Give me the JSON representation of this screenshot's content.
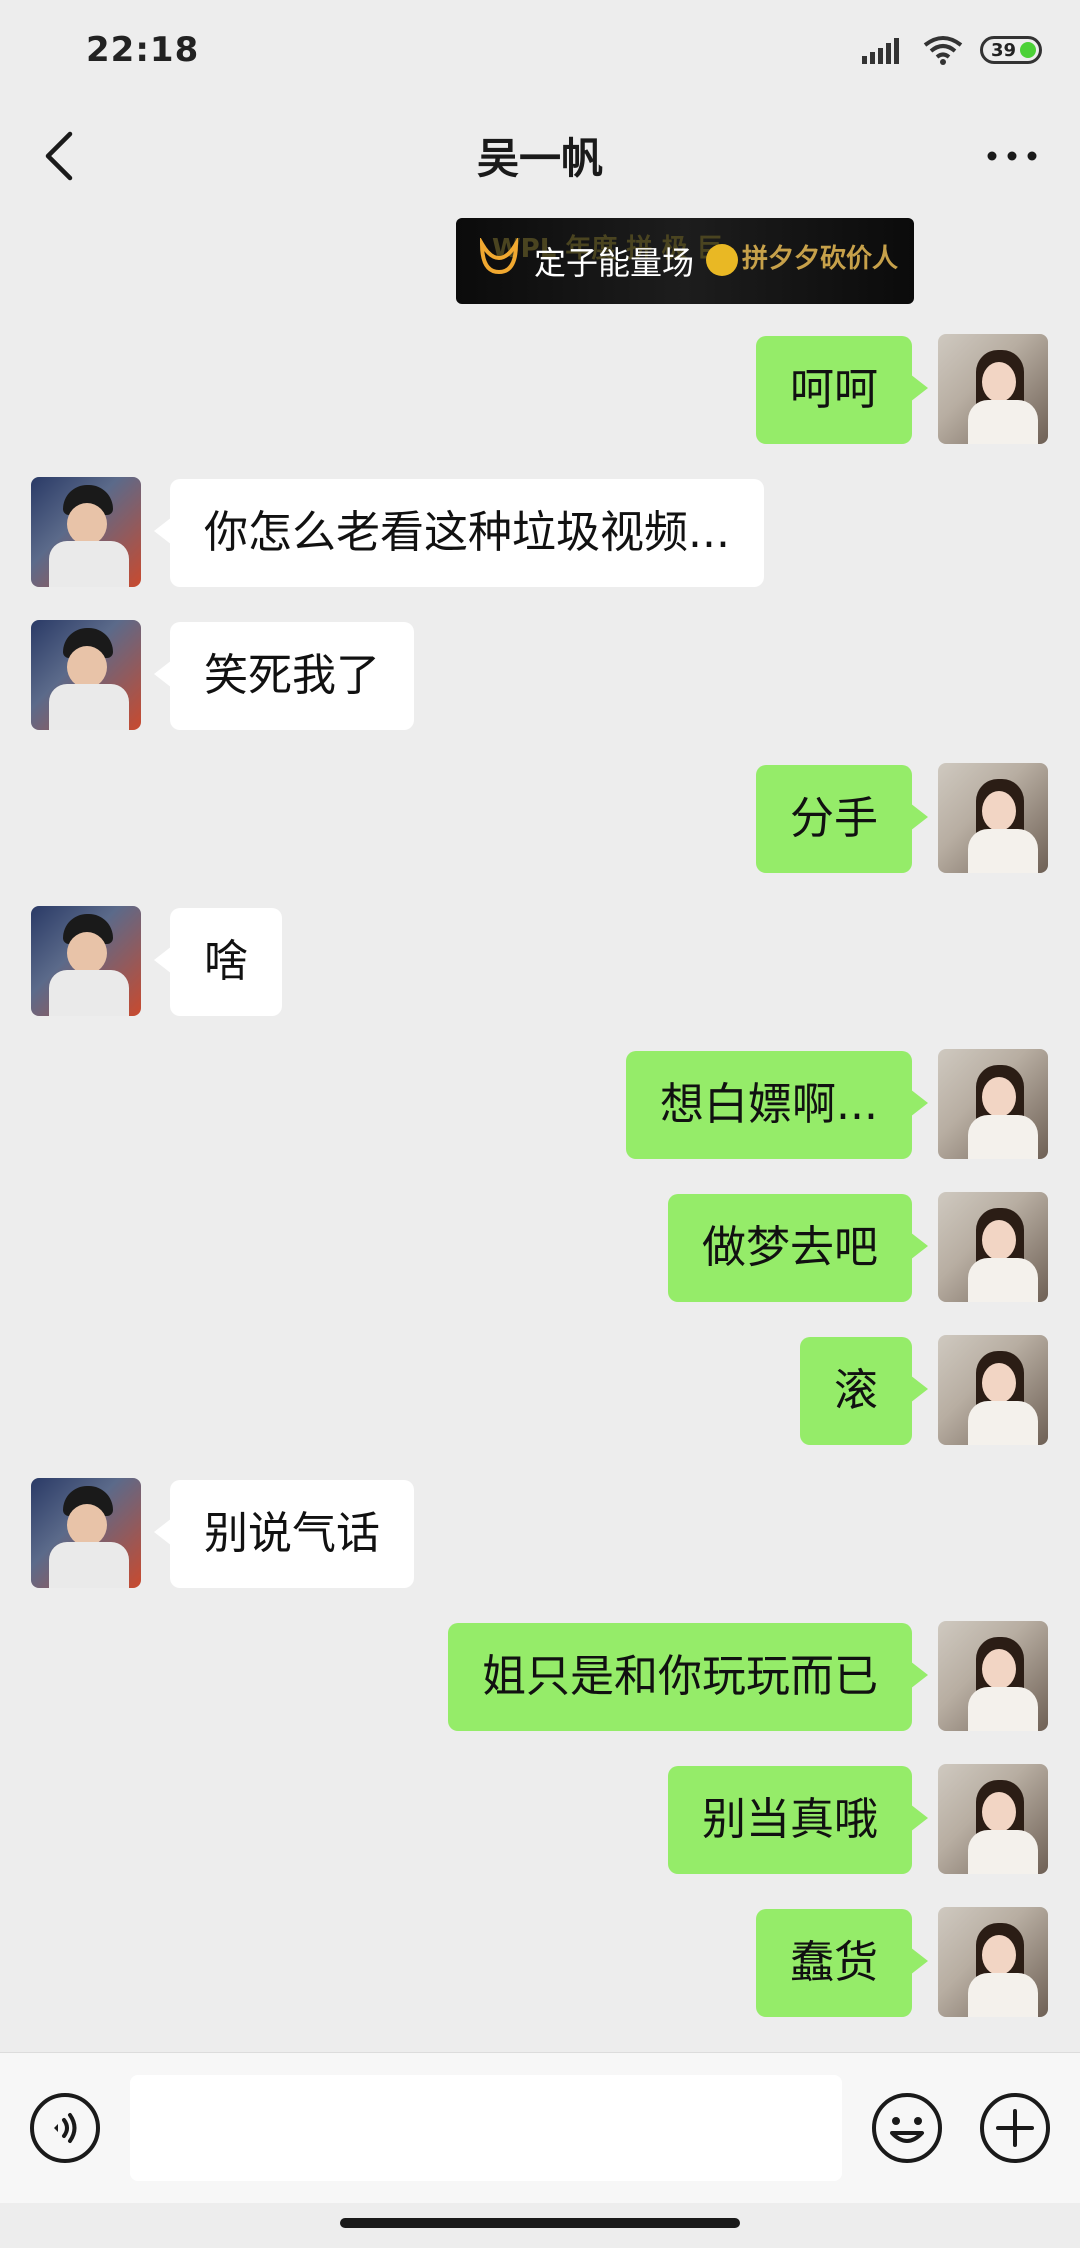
{
  "status_bar": {
    "time": "22:18",
    "battery": "39"
  },
  "header": {
    "title": "吴一帆"
  },
  "ad_banner": {
    "main_text": "定子能量场",
    "faded_text": "WPL 年度 拼 极 巨",
    "right_text": "拼夕夕砍价人"
  },
  "colors": {
    "self_bubble": "#95ec69",
    "other_bubble": "#ffffff",
    "background": "#ededed"
  },
  "messages": [
    {
      "from": "self",
      "text": "呵呵"
    },
    {
      "from": "other",
      "text": "你怎么老看这种垃圾视频..."
    },
    {
      "from": "other",
      "text": "笑死我了"
    },
    {
      "from": "self",
      "text": "分手"
    },
    {
      "from": "other",
      "text": "啥"
    },
    {
      "from": "self",
      "text": "想白嫖啊..."
    },
    {
      "from": "self",
      "text": "做梦去吧"
    },
    {
      "from": "self",
      "text": "滚"
    },
    {
      "from": "other",
      "text": "别说气话"
    },
    {
      "from": "self",
      "text": "姐只是和你玩玩而已"
    },
    {
      "from": "self",
      "text": "别当真哦"
    },
    {
      "from": "self",
      "text": "蠢货"
    }
  ],
  "input_bar": {
    "placeholder": "",
    "icons": [
      "voice-icon",
      "emoji-icon",
      "plus-icon"
    ]
  }
}
